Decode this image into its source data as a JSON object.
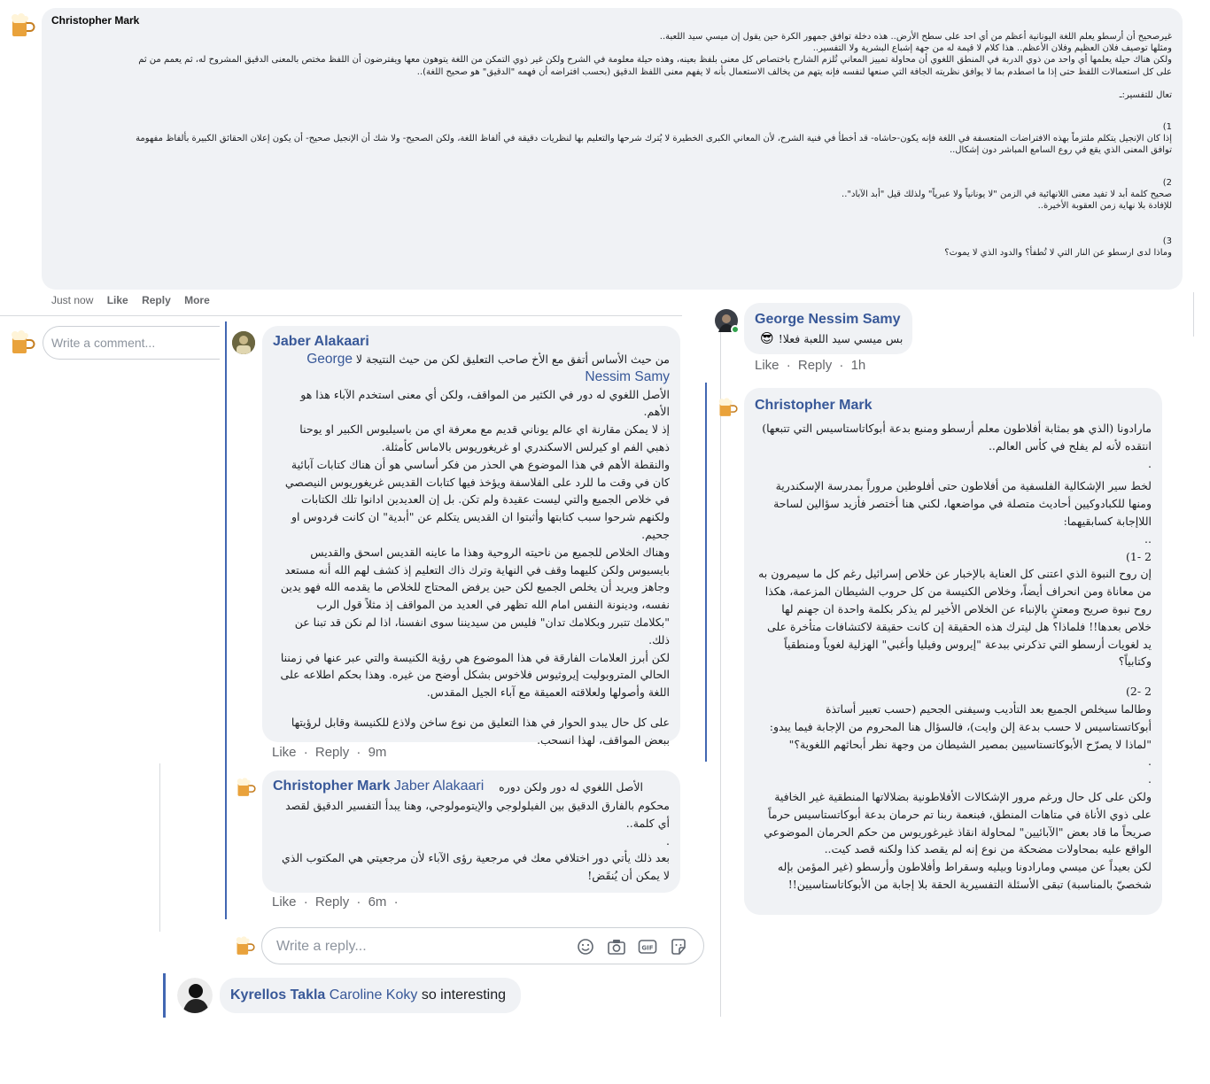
{
  "main_comment": {
    "author": "Christopher Mark",
    "paragraphs": [
      "غيرصحيح أن أرسطو يعلم اللغة اليونانية أعظم من أي احد على سطح الأرض.. هذه دخلة توافق جمهور الكرة حين يقول إن ميسي سيد اللعبة..",
      "ومثلها توصيف فلان العظيم وفلان الأعظم.. هذا كلام لا قيمة له من جهة إشباع البشرية ولا التفسير..",
      "ولكن هناك حيلة يعلمها أي واحد من ذوي الدربة في المنطق اللغوي أن محاولة تمييز المعاني تُلزم الشارح باختصاص كل معنى بلفظ بعينه، وهذه حيلة معلومة في الشرح ولكن غير ذوي التمكن من اللغة يتوهون معها ويفترضون أن اللفظ مختص بالمعنى الدقيق المشروح له، ثم يعمم من ثم",
      "على كل استعمالات اللفظ حتى إذا ما اصطدم بما لا يوافق نظريته الجافة التي صنعها لنفسه فإنه يتهم من يخالف الاستعمال بأنه لا يفهم معنى اللفظ الدقيق (بحسب افتراضه أن فهمه \"الدقيق\" هو صحيح اللغة)..",
      "تعال للتفسير:ـ",
      "1)",
      "إذا كان الإنجيل يتكلم ملتزماً بهذه الافتراضات المتعسفة في اللغة فإنه يكون-حاشاه- قد أخطأ في فنية الشرح، لأن المعاني الكبرى الخطيرة لا يُترك شرحها والتعليم بها لنظريات دقيقة في ألفاظ اللغة، ولكن الصحيح- ولا شك أن الإنجيل صحيح- أن يكون إعلان الحقائق الكبيرة بألفاظ مفهومة",
      "توافق المعنى الذي يقع في روع السامع المباشر دون إشكال..",
      "2)",
      "صحيح كلمة أبد لا تفيد معنى اللانهائية في الزمن \"لا يونانياً ولا عبرياً\" ولذلك قيل \"أبد الآباد\"..",
      "للإفادة بلا نهاية زمن العقوبة الأخيرة..",
      "3)",
      "وماذا لدى ارسطو عن النار التي لا تُطفأ؟ والدود الذي لا يموت؟"
    ],
    "actions": {
      "time": "Just now",
      "like": "Like",
      "reply": "Reply",
      "more": "More"
    }
  },
  "write_comment_placeholder": "Write a comment...",
  "jaber": {
    "author": "Jaber Alakaari",
    "first_line": "من حيث الأساس أتفق مع الأخ صاحب التعليق لكن من حيث النتيجة لا",
    "tag_line1": "George",
    "tag_line2": "Nessim Samy",
    "paragraphs": [
      "الأصل اللغوي له دور في الكثير من المواقف، ولكن أي معنى استخدم الآباء هذا هو الأهم.",
      "إذ لا يمكن مقارنة اي عالم يوناني قديم مع معرفة اي من باسيليوس الكبير او يوحنا ذهبي الفم او كيرلس الاسكندري او غريغوريوس بالاماس كأمثلة.",
      "والنقطة الأهم في هذا الموضوع هي الحذر من فكر أساسي هو أن هناك كتابات آبائية كان في وقت ما للرد على الفلاسفة ويؤخذ فيها كتابات القديس غريغوريوس النيصصي في خلاص الجميع والتي ليست عقيدة ولم تكن. بل إن العديدين ادانوا تلك الكتابات ولكنهم شرحوا سبب كتابتها وأثبتوا ان القديس يتكلم عن \"أبدية\" ان كانت فردوس او جحيم.",
      "وهناك الخلاص للجميع من ناحيته الروحية وهذا ما عاينه القديس اسحق والقديس بايسيوس ولكن كليهما وقف في النهاية وترك ذاك التعليم إذ كشف لهم الله أنه مستعد وجاهز ويريد أن يخلص الجميع لكن حين يرفض المحتاج للخلاص ما يقدمه الله فهو يدين نفسه، ودينونة النفس امام الله تظهر في العديد من المواقف إذ مثلاً قول الرب \"بكلامك تتبرر وبكلامك تدان\" فليس من سيديننا سوى انفسنا، اذا لم نكن قد تبنا عن ذلك.",
      "لكن أبرز العلامات الفارقة في هذا الموضوع هي رؤية الكنيسة والتي عبر عنها في زمننا الحالي المتروبوليت إيروثيوس فلاخوس بشكل أوضح من غيره. وهذا بحكم اطلاعه على اللغة وأصولها ولعلاقته العميقة مع آباء الجيل المقدس.",
      "على كل حال يبدو الحوار في هذا التعليق من نوع ساخن ولاذع للكنيسة وقابل لرؤيتها ببعض المواقف، لهذا انسحب."
    ],
    "actions": {
      "like": "Like",
      "reply": "Reply",
      "time": "9m"
    }
  },
  "mark_reply": {
    "author": "Christopher Mark",
    "tag": "Jaber Alakaari",
    "first_line": "الأصل اللغوي له دور ولكن دوره",
    "paragraphs": [
      "محكوم بالفارق الدقيق بين الفيلولوجي والإيتومولوجي، وهنا يبدأ التفسير الدقيق لقصد أي كلمة..",
      ".",
      "بعد ذلك يأتي دور اختلافي معك في مرجعية رؤى الآباء لأن مرجعيتي هي المكتوب الذي لا يمكن أن يُنقَض!"
    ],
    "actions": {
      "like": "Like",
      "reply": "Reply",
      "time": "6m"
    }
  },
  "write_reply_placeholder": "Write a reply...",
  "kyrellos": {
    "author": "Kyrellos Takla",
    "tag": "Caroline Koky",
    "text": "so interesting"
  },
  "george": {
    "author": "George Nessim Samy",
    "emoji": "😎",
    "text": "بس ميسي سيد اللعبة فعلا!",
    "actions": {
      "like": "Like",
      "reply": "Reply",
      "time": "1h"
    }
  },
  "mark_right": {
    "author": "Christopher Mark",
    "paragraphs": [
      "مارادونا (الذي هو بمثابة أفلاطون معلم أرسطو ومنبع بدعة أبوكاتاستاسيس التي تتبعها) انتقده لأنه لم يفلح في كأس العالم..",
      ".",
      "لخط سير الإشكالية الفلسفية من أفلاطون حتى أفلوطين مروراً بمدرسة الإسكندرية ومنها للكبادوكيين أحاديث متصلة في مواضعها، لكني هنا أختصر فأزيد سؤالين لساحة اللاإجابة كسابقيهما:",
      "..",
      "2 -1)",
      "إن روح النبوة الذي اعتنى كل العناية بالإخبار عن خلاص إسرائيل رغم كل ما سيمرون به من معاناة ومن انحراف أيضاً، وخلاص الكنيسة من كل حروب الشيطان المزعمة، هكذا روح نبوة صريح ومعتنٍ بالإنباء عن الخلاص الأخير لم يذكر بكلمة واحدة ان جهنم لها خلاص بعدها!! فلماذا؟ هل ليترك هذه الحقيقة إن كانت حقيقة لاكتشافات متأخرة على يد لغويات أرسطو التي تذكرني ببدعة \"إيروس وفيليا وأغبي\" الهزلية لغوياً ومنطقياً وكتابياً؟",
      "2 -2)",
      "وطالما سيخلص الجميع بعد التأديب وسيفنى الجحيم (حسب تعبير أساتذة أبوكاتستاسيس لا حسب بدعة إلن وايت)، فالسؤال هنا المحروم من الإجابة فيما يبدو:",
      "\"لماذا لا يصرّح الأبوكاتستاسيين بمصير الشيطان من وجهة نظر أبحاثهم اللغوية؟\"",
      ".",
      ".",
      "ولكن على كل حال ورغم مرور الإشكالات الأفلاطونية بضلالاتها المنطقية غير الخافية على ذوي الأناة في متاهات المنطق، فبنعمة ربنا تم حرمان بدعة أبوكاتستاسيس حرماً صريحاً ما قاد بعض \"الآبائيين\" لمحاولة انقاذ غيرغوريوس من حكم الحرمان الموضوعي الواقع عليه بمحاولات مضحكة من نوع إنه لم يقصد كذا ولكنه قصد كيت..",
      "لكن بعيداً عن ميسي ومارادونا وبيليه وسقراط وأفلاطون وأرسطو (غير المؤمن بإله شخصيّ بالمناسبة) تبقى الأسئلة التفسيرية الحقة بلا إجابة من الأبوكاتاستاسيين!!"
    ]
  }
}
